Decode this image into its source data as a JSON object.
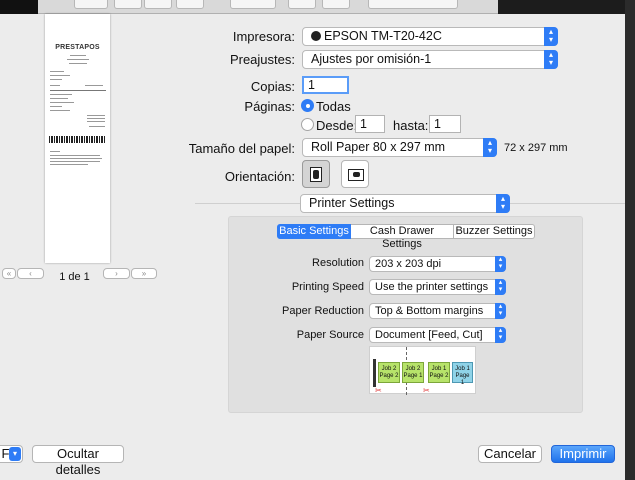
{
  "window": {
    "page_indicator": "1 de 1"
  },
  "preview": {
    "brand": "PRESTAPOS"
  },
  "form": {
    "printer_label": "Impresora:",
    "printer_value": "EPSON TM-T20-42C",
    "presets_label": "Preajustes:",
    "presets_value": "Ajustes por omisión-1",
    "copies_label": "Copias:",
    "copies_value": "1",
    "pages_label": "Páginas:",
    "pages_all_label": "Todas",
    "pages_from_label": "Desde:",
    "pages_from_value": "1",
    "pages_to_label": "hasta:",
    "pages_to_value": "1",
    "paper_size_label": "Tamaño del papel:",
    "paper_size_value": "Roll Paper 80 x 297 mm",
    "paper_size_dims": "72 x 297 mm",
    "orientation_label": "Orientación:",
    "section_value": "Printer Settings"
  },
  "tabs": [
    "Basic Settings",
    "Cash Drawer Settings",
    "Buzzer Settings"
  ],
  "settings": {
    "resolution_label": "Resolution",
    "resolution_value": "203 x 203 dpi",
    "speed_label": "Printing Speed",
    "speed_value": "Use the printer settings",
    "reduction_label": "Paper Reduction",
    "reduction_value": "Top & Bottom margins",
    "source_label": "Paper Source",
    "source_value": "Document [Feed, Cut]"
  },
  "diagram": {
    "job2": "Job 2",
    "job1": "Job 1",
    "page2": "Page 2",
    "page1": "Page 1"
  },
  "footer": {
    "pdf_label": "F",
    "hide_details": "Ocultar detalles",
    "cancel": "Cancelar",
    "print": "Imprimir"
  },
  "colors": {
    "accent": "#2e7cf6",
    "job_green": "#b7e36a",
    "job_blue": "#8fd3e8"
  }
}
